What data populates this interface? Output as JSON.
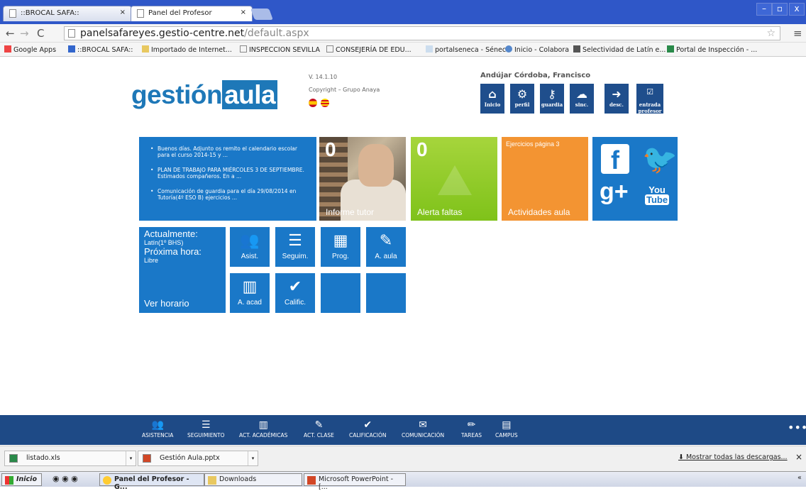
{
  "browser": {
    "tabs": [
      {
        "label": "::BROCAL SAFA::"
      },
      {
        "label": "Panel del Profesor"
      }
    ],
    "url_host": "panelsafareyes.gestio-centre.net",
    "url_path": "/default.aspx",
    "bookmarks": [
      "Google Apps",
      "::BROCAL SAFA::",
      "Importado de Internet...",
      "INSPECCION SEVILLA",
      "CONSEJERÍA DE EDU...",
      "portalseneca - Séneca",
      "Inicio - Colabora",
      "Selectividad de Latín e...",
      "Portal de Inspección - ..."
    ]
  },
  "header": {
    "logo_1": "gestión",
    "logo_2": "aula",
    "version": "V. 14.1.10",
    "copyright": "Copyright – Grupo Anaya",
    "user": "Andújar Córdoba, Francisco",
    "buttons": [
      {
        "label": "Inicio",
        "icon": "home-icon"
      },
      {
        "label": "perfil",
        "icon": "gears-icon"
      },
      {
        "label": "guardia",
        "icon": "key-icon"
      },
      {
        "label": "sinc.",
        "icon": "cloud-upload-icon"
      },
      {
        "label": "desc.",
        "icon": "logout-icon"
      },
      {
        "label": "entrada profesor",
        "icon": "check-icon"
      }
    ]
  },
  "news": [
    "Buenos días. Adjunto os remito el calendario escolar para el curso 2014-15 y ...",
    "PLAN DE TRABAJO PARA MIÉRCOLES 3 DE SEPTIEMBRE. Estimados compañeros. En a ...",
    "Comunicación de guardia para el día 29/08/2014 en Tutoría(4º ESO B) ejercicios ..."
  ],
  "tiles": {
    "tutor": {
      "count": "0",
      "label": "Informe tutor"
    },
    "alerta": {
      "count": "0",
      "label": "Alerta faltas"
    },
    "actividades": {
      "sub": "Ejercicios página 3",
      "label": "Actividades aula"
    },
    "social": {
      "youtube_1": "You",
      "youtube_2": "Tube"
    }
  },
  "horario": {
    "actual_label": "Actualmente:",
    "actual_value": "Latín(1º BHS)",
    "next_label": "Próxima hora:",
    "next_value": "Libre",
    "link": "Ver horario"
  },
  "shortcuts": [
    {
      "label": "Asist.",
      "icon": "users-icon"
    },
    {
      "label": "Seguim.",
      "icon": "list-icon"
    },
    {
      "label": "Prog.",
      "icon": "calendar-icon"
    },
    {
      "label": "A. aula",
      "icon": "edit-icon"
    },
    {
      "label": "A. acad",
      "icon": "bar-chart-icon"
    },
    {
      "label": "Calific.",
      "icon": "check-circle-icon"
    }
  ],
  "bottom_menu": [
    "ASISTENCIA",
    "SEGUIMIENTO",
    "ACT. ACADÉMICAS",
    "ACT. CLASE",
    "CALIFICACIÓN",
    "COMUNICACIÓN",
    "TAREAS",
    "CAMPUS"
  ],
  "downloads": {
    "files": [
      "listado.xls",
      "Gestión Aula.pptx"
    ],
    "show_all": "Mostrar todas las descargas..."
  },
  "taskbar": {
    "start": "Inicio",
    "items": [
      "Panel del Profesor - G...",
      "Downloads",
      "Microsoft PowerPoint - [..."
    ]
  }
}
